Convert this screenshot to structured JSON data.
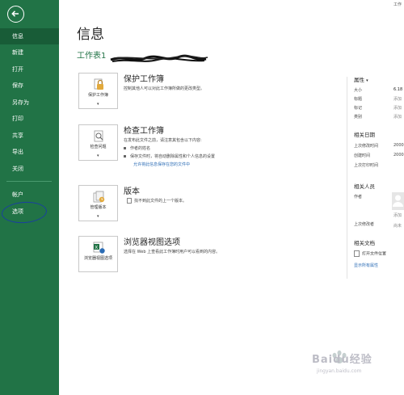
{
  "app": {
    "top_right": "工作"
  },
  "sidebar": {
    "items": [
      {
        "label": "信息",
        "active": true
      },
      {
        "label": "新建"
      },
      {
        "label": "打开"
      },
      {
        "label": "保存"
      },
      {
        "label": "另存为"
      },
      {
        "label": "打印"
      },
      {
        "label": "共享"
      },
      {
        "label": "导出"
      },
      {
        "label": "关闭"
      },
      {
        "label": "帐户"
      },
      {
        "label": "选项"
      }
    ]
  },
  "main": {
    "title": "信息",
    "doc_name": "工作表1",
    "sections": [
      {
        "button_label": "保护工作簿",
        "title": "保护工作簿",
        "desc": "控制其他人可以对此工作簿所做的更改类型。"
      },
      {
        "button_label": "检查问题",
        "title": "检查工作簿",
        "desc": "在发布此文件之前，请注意其包含以下内容:",
        "bullets": [
          "作者的姓名",
          "保存文件时，将自动删除属性和个人信息的设置"
        ],
        "link": "允许将此信息保存在您的文件中"
      },
      {
        "button_label": "管理版本",
        "title": "版本",
        "desc": "找不到此文件的上一个版本。"
      },
      {
        "button_label": "浏览器视图选项",
        "title": "浏览器视图选项",
        "desc": "选择在 Web 上查看此工作簿时用户可以看到的内容。"
      }
    ]
  },
  "properties": {
    "header": "属性",
    "rows": [
      {
        "label": "大小",
        "value": "6.18"
      },
      {
        "label": "标题",
        "value": "添加"
      },
      {
        "label": "标记",
        "value": "添加"
      },
      {
        "label": "类别",
        "value": "添加"
      }
    ]
  },
  "related_dates": {
    "header": "相关日期",
    "rows": [
      {
        "label": "上次修改时间",
        "value": "2000"
      },
      {
        "label": "创建时间",
        "value": "2000"
      },
      {
        "label": "上次打印时间",
        "value": ""
      }
    ]
  },
  "related_people": {
    "header": "相关人员",
    "author_label": "作者",
    "add_author": "添加",
    "last_modified_by": "上次修改者",
    "last_modified_value": "尚未"
  },
  "related_docs": {
    "header": "相关文档",
    "open_location": "打开文件位置",
    "show_all": "显示所有属性"
  },
  "watermark": {
    "text": "Baidu经验",
    "sub": "jingyan.baidu.com"
  }
}
